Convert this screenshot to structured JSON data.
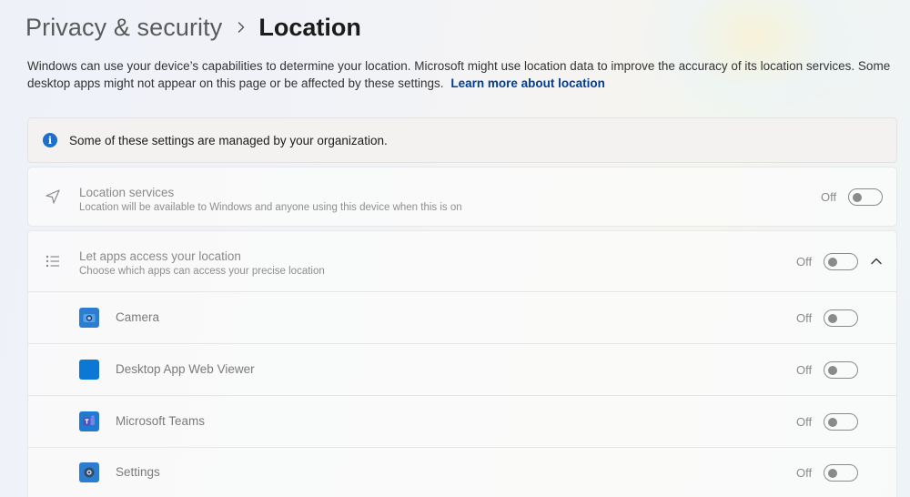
{
  "breadcrumb": {
    "parent": "Privacy & security",
    "current": "Location"
  },
  "description": {
    "text": "Windows can use your device’s capabilities to determine your location. Microsoft might use location data to improve the accuracy of its location services. Some desktop apps might not appear on this page or be affected by these settings.",
    "link": "Learn more about location"
  },
  "info_bar": {
    "icon": "info-icon",
    "text": "Some of these settings are managed by your organization."
  },
  "location_services": {
    "icon": "location-arrow-icon",
    "title": "Location services",
    "subtitle": "Location will be available to Windows and anyone using this device when this is on",
    "state": "Off"
  },
  "app_access": {
    "icon": "list-icon",
    "title": "Let apps access your location",
    "subtitle": "Choose which apps can access your precise location",
    "state": "Off",
    "expanded": true
  },
  "apps": [
    {
      "name": "Camera",
      "state": "Off",
      "icon": "camera-app-icon"
    },
    {
      "name": "Desktop App Web Viewer",
      "state": "Off",
      "icon": "web-viewer-app-icon"
    },
    {
      "name": "Microsoft Teams",
      "state": "Off",
      "icon": "teams-app-icon"
    },
    {
      "name": "Settings",
      "state": "Off",
      "icon": "settings-app-icon"
    }
  ],
  "colors": {
    "accent": "#0067c0",
    "link": "#003e92",
    "info": "#1e6fc7"
  }
}
